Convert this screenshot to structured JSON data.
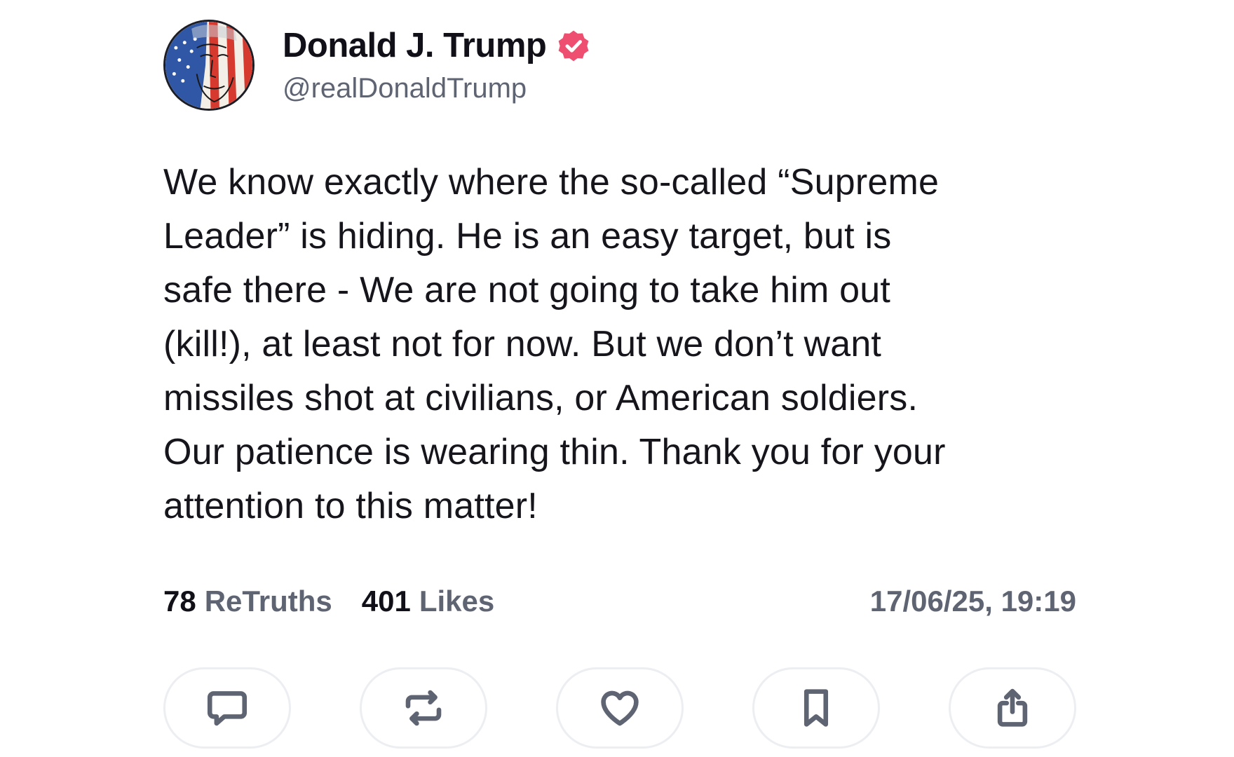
{
  "post": {
    "author": {
      "display_name": "Donald J. Trump",
      "handle": "@realDonaldTrump",
      "verified": true,
      "verified_color": "#ee4e6f",
      "avatar_icon": "flag-portrait-avatar"
    },
    "body": "We know exactly where the so-called “Supreme\nLeader” is hiding. He is an easy target, but is\nsafe there - We are not going to take him out\n(kill!), at least not for now. But we don’t want\nmissiles shot at civilians, or American soldiers.\nOur patience is wearing thin. Thank you for your\nattention to this matter!",
    "stats": {
      "retruths_count": "78",
      "retruths_label": "ReTruths",
      "likes_count": "401",
      "likes_label": "Likes",
      "timestamp": "17/06/25, 19:19"
    }
  },
  "actions": [
    {
      "name": "reply",
      "icon": "comment-icon"
    },
    {
      "name": "retruth",
      "icon": "repost-icon"
    },
    {
      "name": "like",
      "icon": "heart-icon"
    },
    {
      "name": "bookmark",
      "icon": "bookmark-icon"
    },
    {
      "name": "share",
      "icon": "share-icon"
    }
  ],
  "colors": {
    "text_primary": "#111018",
    "text_secondary": "#5f6473",
    "button_border": "#eceef2"
  }
}
